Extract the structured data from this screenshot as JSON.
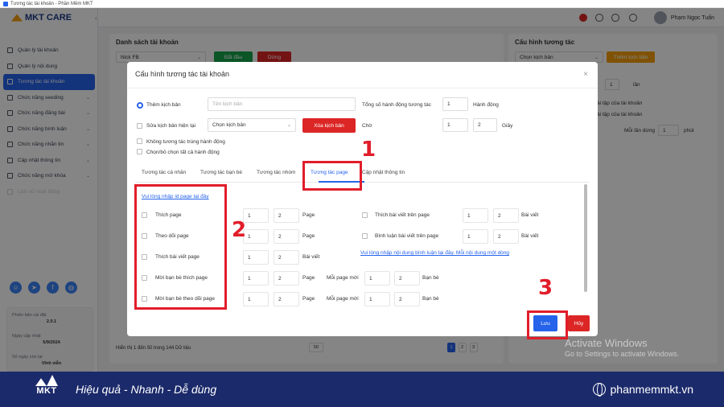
{
  "window_title": "Tương tác tài khoản - Phần Mềm MKT",
  "sidebar": {
    "logo_text": "MKT CARE",
    "items": [
      {
        "label": "Quản lý tài khoản",
        "chevron": false
      },
      {
        "label": "Quản lý nội dung",
        "chevron": false
      },
      {
        "label": "Tương tác tài khoản",
        "chevron": false
      },
      {
        "label": "Chức năng seeding",
        "chevron": true
      },
      {
        "label": "Chức năng đăng bài",
        "chevron": true
      },
      {
        "label": "Chức năng bình luận",
        "chevron": true
      },
      {
        "label": "Chức năng nhắn tin",
        "chevron": true
      },
      {
        "label": "Cập nhật thông tin",
        "chevron": true
      },
      {
        "label": "Chức năng mở khóa",
        "chevron": true
      },
      {
        "label": "Lịch sử hoạt động",
        "chevron": false
      }
    ],
    "info": {
      "version_label": "Phiên bản cài đặt",
      "version_value": "2.0.1",
      "update_label": "Ngày cập nhật",
      "update_value": "5/9/2024",
      "days_label": "Số ngày còn lại",
      "days_value": "Vĩnh viễn"
    }
  },
  "topbar": {
    "user_name": "Phạm Ngọc Tuấn"
  },
  "background": {
    "left_panel_title": "Danh sách tài khoản",
    "account_select": "Nick FB",
    "start_button": "Bắt đầu",
    "stop_button": "Dừng",
    "right_panel_title": "Cấu hình tương tác",
    "scenario_select": "Chọn kịch bản",
    "add_scenario_button": "Thêm kịch bản",
    "bg_val1": "1",
    "bg_lan": "lần",
    "bg_text1": "ài tập của tài khoản",
    "bg_text2": "ài tập của tài khoản",
    "bg_each_time": "Mỗi lần dừng",
    "bg_val2": "1",
    "bg_unit": "phút",
    "footer_text": "Hiển thị 1 đến 50 trong 144 Dữ liệu",
    "page_size": "50",
    "pages": [
      "1",
      "2",
      "3"
    ]
  },
  "modal": {
    "title": "Cấu hình tương tác tài khoản",
    "add_scenario_label": "Thêm kịch bản",
    "scenario_name_placeholder": "Tên kịch bản",
    "total_actions_label": "Tổng số hành động tương tác",
    "total_actions_value": "1",
    "actions_unit": "Hành động",
    "edit_current_label": "Sửa kịch bản hiện tại",
    "choose_scenario": "Chọn kịch bản",
    "delete_scenario_button": "Xóa kịch bản",
    "wait_label": "Chờ",
    "wait_from": "1",
    "wait_to": "2",
    "wait_unit": "Giây",
    "no_duplicate_label": "Không tương tác trùng hành động",
    "select_all_label": "Chọn/bỏ chọn tất cả hành động",
    "tabs": [
      "Tương tác cá nhân",
      "Tương tác bạn bè",
      "Tương tác nhóm",
      "Tương tác page",
      "Cập nhật thông tin"
    ],
    "active_tab": 3,
    "page_id_link": "Vui lòng nhập id page tại đây",
    "left_actions": [
      {
        "label": "Thích page",
        "from": "1",
        "to": "2",
        "unit": "Page",
        "each_label": "",
        "each_from": "",
        "each_to": "",
        "each_unit": ""
      },
      {
        "label": "Theo dõi page",
        "from": "1",
        "to": "2",
        "unit": "Page",
        "each_label": "",
        "each_from": "",
        "each_to": "",
        "each_unit": ""
      },
      {
        "label": "Thích bài viết page",
        "from": "1",
        "to": "2",
        "unit": "Bài viết",
        "each_label": "",
        "each_from": "",
        "each_to": "",
        "each_unit": ""
      },
      {
        "label": "Mời bạn bè thích page",
        "from": "1",
        "to": "2",
        "unit": "Page",
        "each_label": "Mỗi page mời",
        "each_from": "1",
        "each_to": "2",
        "each_unit": "Bạn bè"
      },
      {
        "label": "Mời bạn bè theo dõi page",
        "from": "1",
        "to": "2",
        "unit": "Page",
        "each_label": "Mỗi page mời",
        "each_from": "1",
        "each_to": "2",
        "each_unit": "Bạn bè"
      }
    ],
    "right_actions": [
      {
        "label": "Thích bài viết trên page",
        "from": "1",
        "to": "2",
        "unit": "Bài viết"
      },
      {
        "label": "Bình luận bài viết trên page",
        "from": "1",
        "to": "2",
        "unit": "Bài viết"
      }
    ],
    "comment_link": "Vui lòng nhập nội dung bình luận tại đây. Mỗi nội dung một dòng",
    "save_button": "Lưu",
    "cancel_button": "Hủy"
  },
  "annotations": {
    "n1": "1",
    "n2": "2",
    "n3": "3",
    "color": "#e11d2a"
  },
  "watermark": {
    "line1": "Activate Windows",
    "line2": "Go to Settings to activate Windows."
  },
  "banner": {
    "logo_text": "MKT",
    "slogan": "Hiệu quả - Nhanh - Dễ dùng",
    "website": "phanmemmkt.vn"
  },
  "colors": {
    "primary": "#2563eb",
    "danger": "#dc2626",
    "banner": "#1b2a6b"
  }
}
